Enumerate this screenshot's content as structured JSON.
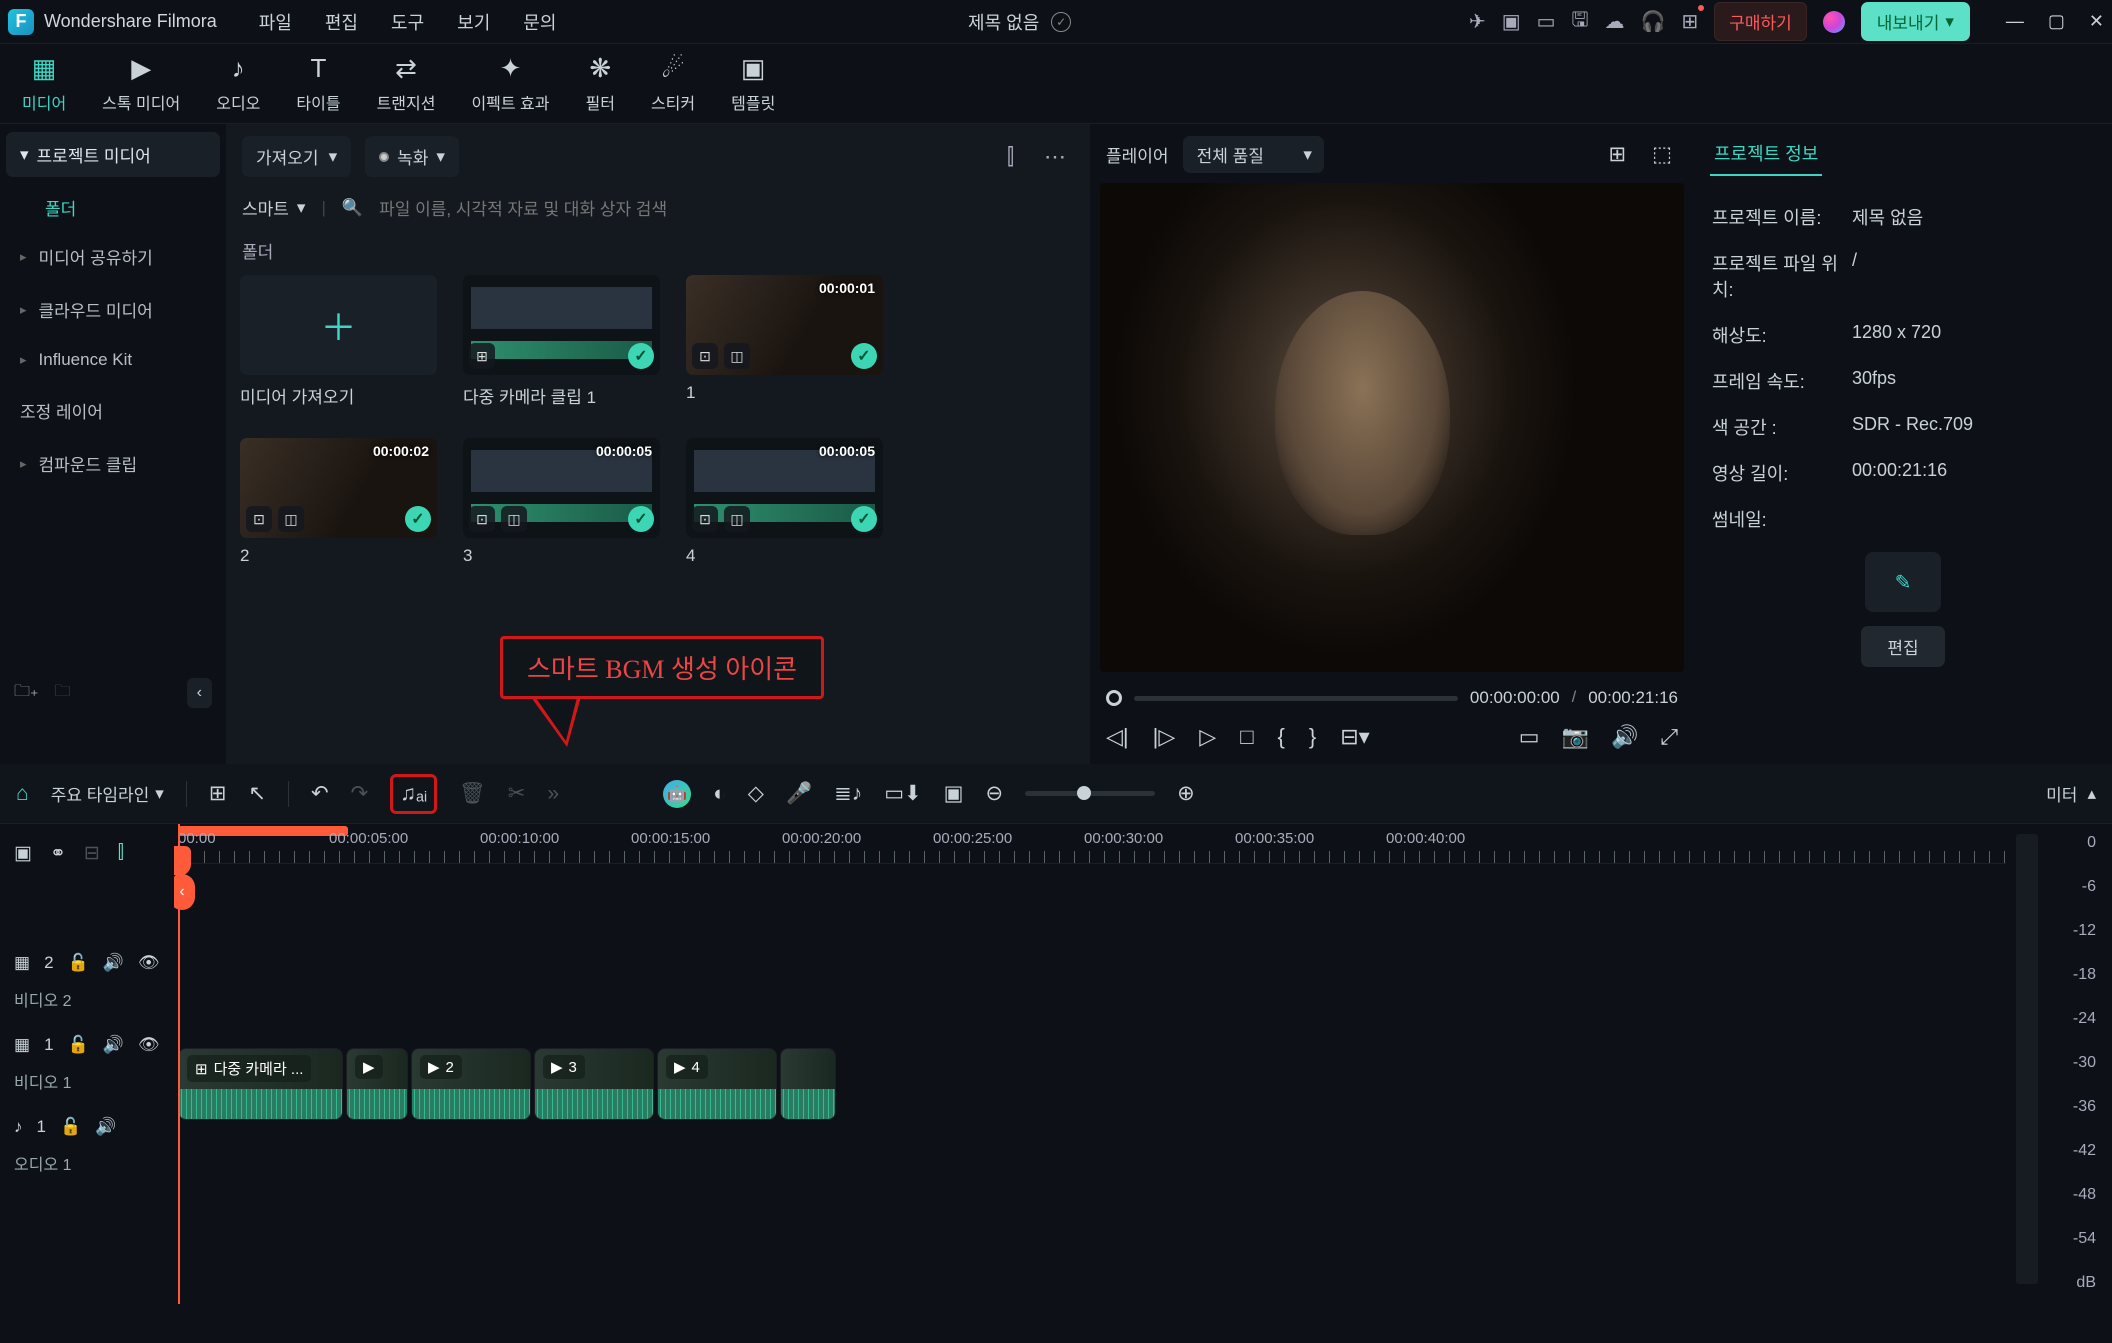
{
  "app": {
    "name": "Wondershare Filmora",
    "title": "제목 없음"
  },
  "menus": [
    "파일",
    "편집",
    "도구",
    "보기",
    "문의"
  ],
  "buy_label": "구매하기",
  "export_label": "내보내기",
  "toptabs": [
    {
      "label": "미디어",
      "icon": "▦"
    },
    {
      "label": "스톡 미디어",
      "icon": "▶"
    },
    {
      "label": "오디오",
      "icon": "♪"
    },
    {
      "label": "타이틀",
      "icon": "T"
    },
    {
      "label": "트랜지션",
      "icon": "⇄"
    },
    {
      "label": "이펙트 효과",
      "icon": "✦"
    },
    {
      "label": "필터",
      "icon": "❋"
    },
    {
      "label": "스티커",
      "icon": "☄"
    },
    {
      "label": "템플릿",
      "icon": "▣"
    }
  ],
  "sidebar": {
    "head": "프로젝트 미디어",
    "folder": "폴더",
    "items": [
      "미디어 공유하기",
      "클라우드 미디어",
      "Influence Kit",
      "조정 레이어",
      "컴파운드 클립"
    ]
  },
  "media": {
    "import": "가져오기",
    "record": "녹화",
    "smart": "스마트",
    "search_placeholder": "파일 이름, 시각적 자료 및 대화 상자 검색",
    "section": "폴더",
    "cells": [
      {
        "caption": "미디어 가져오기",
        "type": "add"
      },
      {
        "caption": "다중 카메라 클립 1",
        "type": "edit"
      },
      {
        "caption": "1",
        "type": "clip",
        "tc": "00:00:01"
      },
      {
        "caption": "2",
        "type": "clip",
        "tc": "00:00:02"
      },
      {
        "caption": "3",
        "type": "edit",
        "tc": "00:00:05"
      },
      {
        "caption": "4",
        "type": "edit",
        "tc": "00:00:05"
      }
    ]
  },
  "callout_text": "스마트 BGM 생성 아이콘",
  "player": {
    "label": "플레이어",
    "quality": "전체 품질",
    "current": "00:00:00:00",
    "total": "00:00:21:16"
  },
  "info": {
    "title": "프로젝트 정보",
    "rows": [
      {
        "k": "프로젝트 이름:",
        "v": "제목 없음"
      },
      {
        "k": "프로젝트 파일 위치:",
        "v": "/"
      },
      {
        "k": "해상도:",
        "v": "1280 x 720"
      },
      {
        "k": "프레임 속도:",
        "v": "30fps"
      },
      {
        "k": "색 공간 :",
        "v": "SDR - Rec.709"
      },
      {
        "k": "영상 길이:",
        "v": "00:00:21:16"
      },
      {
        "k": "썸네일:",
        "v": ""
      }
    ],
    "edit": "편집"
  },
  "timeline": {
    "label": "주요 타임라인",
    "meter": "미터",
    "ticks": [
      "00:00",
      "00:00:05:00",
      "00:00:10:00",
      "00:00:15:00",
      "00:00:20:00",
      "00:00:25:00",
      "00:00:30:00",
      "00:00:35:00",
      "00:00:40:00"
    ],
    "tracks": {
      "v2": "비디오 2",
      "v1": "비디오 1",
      "a1": "오디오 1"
    },
    "clips": [
      {
        "label": "다중 카메라 ..."
      },
      {
        "label": ""
      },
      {
        "label": "2"
      },
      {
        "label": "3"
      },
      {
        "label": "4"
      },
      {
        "label": ""
      }
    ],
    "db_scale": [
      "0",
      "-6",
      "-12",
      "-18",
      "-24",
      "-30",
      "-36",
      "-42",
      "-48",
      "-54",
      "dB"
    ]
  }
}
